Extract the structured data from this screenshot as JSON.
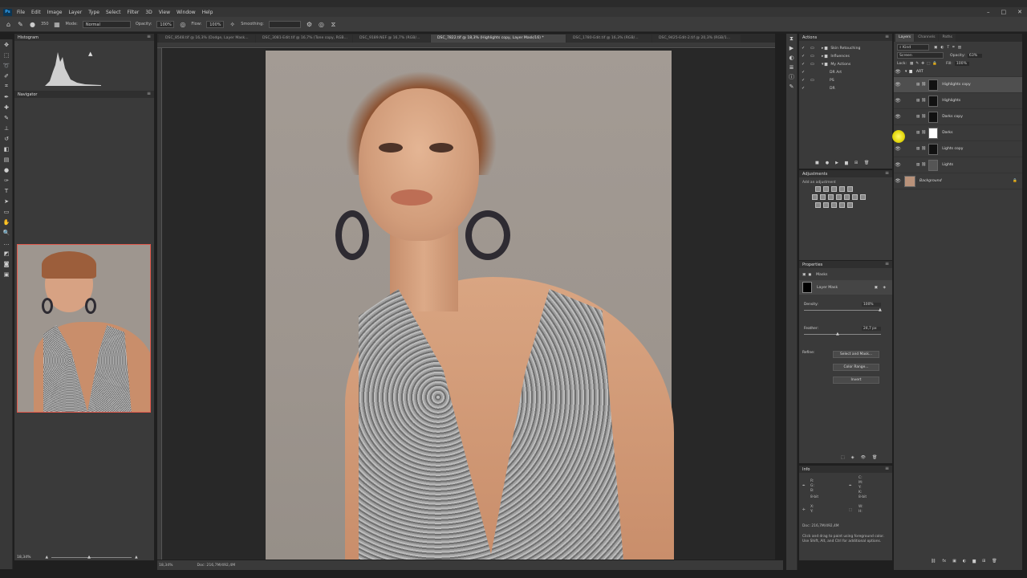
{
  "menu": {
    "app_badge": "Ps",
    "items": [
      "File",
      "Edit",
      "Image",
      "Layer",
      "Type",
      "Select",
      "Filter",
      "3D",
      "View",
      "Window",
      "Help"
    ]
  },
  "options": {
    "mode_label": "Mode:",
    "mode_value": "Normal",
    "opacity_label": "Opacity:",
    "opacity_value": "100%",
    "flow_label": "Flow:",
    "flow_value": "100%",
    "smoothing_label": "Smoothing:",
    "brush_size": "350"
  },
  "doc_tabs": [
    "DSC_8548.tif @ 16,3% (Dodge, Layer Mask...",
    "DSC_3081-Edit.tif @ 16,7% (Tone copy, RGB...",
    "DSC_9189.NEF @ 16,7% (RGB/...",
    "DSC_7822.tif @ 18,3% (Highlights copy, Layer Mask/16) *",
    "DSC_1780-Edit.tif @ 16,3% (RGB/...",
    "DSC_9425-Edit-2.tif @ 20,3% (RGB/1..."
  ],
  "left_panels": {
    "histogram": "Histogram",
    "navigator": "Navigator",
    "zoom": "18,34%"
  },
  "status": {
    "zoom": "18,34%",
    "doc": "Doc: 216,7M/492,4M"
  },
  "actions": {
    "title": "Actions",
    "items": [
      "Skin Retouching",
      "Influences",
      "My Actions",
      "DR Art",
      "PS",
      "DR"
    ]
  },
  "adjustments": {
    "title": "Adjustments",
    "hint": "Add an adjustment"
  },
  "properties": {
    "title": "Properties",
    "masks_label": "Masks",
    "layer_mask": "Layer Mask",
    "density_label": "Density:",
    "density_value": "100%",
    "feather_label": "Feather:",
    "feather_value": "24,7 px",
    "refine_label": "Refine:",
    "select_mask_btn": "Select and Mask...",
    "color_range_btn": "Color Range...",
    "invert_btn": "Invert"
  },
  "info": {
    "title": "Info",
    "r_lbl": "R:",
    "g_lbl": "G:",
    "b_lbl": "B:",
    "c_lbl": "C:",
    "m_lbl": "M:",
    "y_lbl": "Y:",
    "k_lbl": "K:",
    "bit_left": "8-bit",
    "bit_right": "8-bit",
    "x_lbl": "X:",
    "y2_lbl": "Y:",
    "w_lbl": "W:",
    "h_lbl": "H:",
    "doc": "Doc: 216,7M/492,4M",
    "tip": "Click and drag to paint using foreground color.  Use Shift, Alt, and Ctrl for additional options."
  },
  "layers_panel": {
    "tabs": [
      "Layers",
      "Channels",
      "Paths"
    ],
    "kind": "Kind",
    "blend": "Screen",
    "opacity_label": "Opacity:",
    "opacity_value": "63%",
    "lock_label": "Lock:",
    "fill_label": "Fill:",
    "fill_value": "100%",
    "group": "ART",
    "layers": [
      "Highlights copy",
      "Highlights",
      "Darks copy",
      "Darks",
      "Lights copy",
      "Lights"
    ],
    "background": "Background"
  }
}
